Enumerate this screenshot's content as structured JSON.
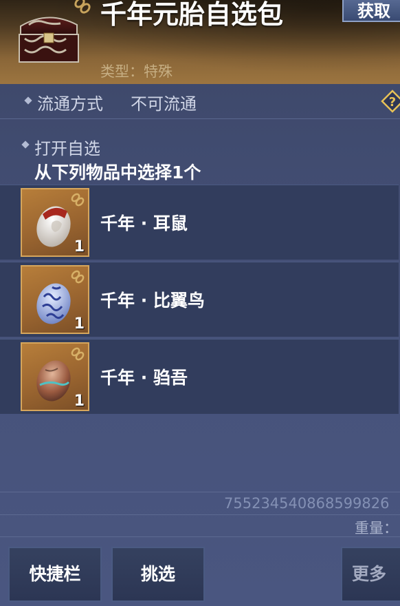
{
  "header": {
    "title": "千年元胎自选包",
    "type_line": "类型：特殊",
    "obtain_label": "获取",
    "item_icon": "treasure-chest-icon"
  },
  "circulation": {
    "label": "流通方式",
    "value": "不可流通",
    "help_icon": "question-diamond-icon"
  },
  "open_choice": {
    "label": "打开自选",
    "instruction": "从下列物品中选择1个"
  },
  "items": [
    {
      "name": "千年 · 耳鼠",
      "qty": "1",
      "icon": "white-red-egg-icon"
    },
    {
      "name": "千年 · 比翼鸟",
      "qty": "1",
      "icon": "blue-patterned-egg-icon"
    },
    {
      "name": "千年 · 驺吾",
      "qty": "1",
      "icon": "bronze-egg-icon"
    }
  ],
  "footer": {
    "item_id": "755234540868599826",
    "weight_label": "重量：",
    "buttons": {
      "quick_bar": "快捷栏",
      "pick": "挑选",
      "more": "更多"
    }
  },
  "colors": {
    "panel_bg": "#46527a",
    "header_gold": "#9c7540",
    "slot_border": "#d6a65c",
    "type_text": "#c6ae83"
  }
}
